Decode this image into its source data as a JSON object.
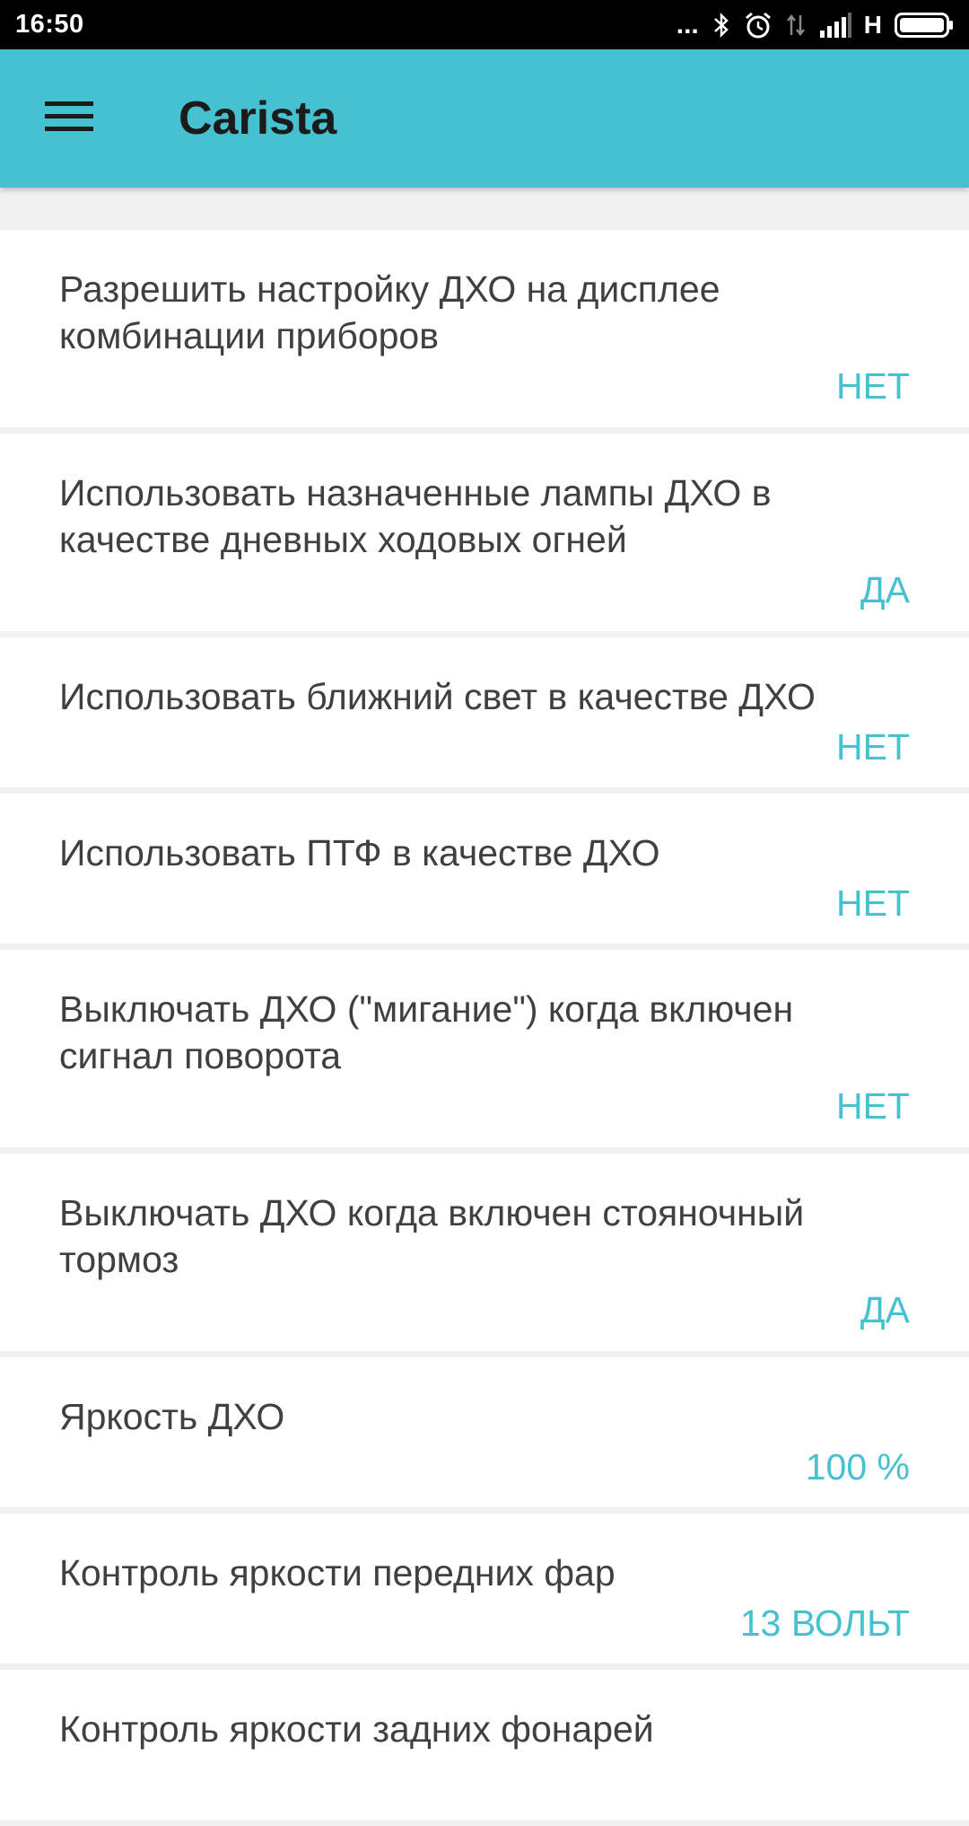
{
  "status_bar": {
    "time": "16:50",
    "dots": "...",
    "network": "H",
    "icons": [
      "bluetooth-icon",
      "alarm-icon",
      "data-transfer-icon",
      "signal-icon",
      "battery-icon"
    ]
  },
  "app_bar": {
    "title": "Carista",
    "menu_icon": "hamburger-menu-icon",
    "background": "#45c1d0"
  },
  "accent_color": "#45c1d0",
  "settings": [
    {
      "title": "Разрешить настройку ДХО на дисплее комбинации приборов",
      "value": "НЕТ"
    },
    {
      "title": "Использовать назначенные лампы ДХО в качестве дневных ходовых огней",
      "value": "ДА"
    },
    {
      "title": "Использовать ближний свет в качестве ДХО",
      "value": "НЕТ"
    },
    {
      "title": "Использовать ПТФ в качестве ДХО",
      "value": "НЕТ"
    },
    {
      "title": "Выключать ДХО (\"мигание\") когда включен сигнал поворота",
      "value": "НЕТ"
    },
    {
      "title": "Выключать ДХО когда включен стояночный тормоз",
      "value": "ДА"
    },
    {
      "title": "Яркость ДХО",
      "value": "100 %"
    },
    {
      "title": "Контроль яркости передних фар",
      "value": "13 ВОЛЬТ"
    },
    {
      "title": "Контроль яркости задних фонарей",
      "value": ""
    }
  ]
}
